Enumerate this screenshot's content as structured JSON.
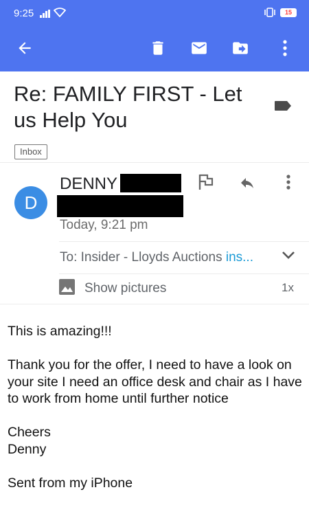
{
  "status_bar": {
    "time": "9:25",
    "battery": "15"
  },
  "toolbar": {
    "back_icon": "arrow-left-icon",
    "delete_icon": "trash-icon",
    "mark_unread_icon": "mail-icon",
    "move_icon": "folder-move-icon",
    "more_icon": "more-vert-icon"
  },
  "email": {
    "subject": "Re: FAMILY FIRST - Let us Help You",
    "label_chip": "Inbox",
    "sender_initial": "D",
    "sender_name": "DENNY",
    "date": "Today, 9:21 pm",
    "to_prefix": "To: Insider - Lloyds Auctions ",
    "to_email": "ins...",
    "show_pictures": "Show pictures",
    "zoom": "1x",
    "body": {
      "line1": "This is amazing!!!",
      "para2": "Thank you for the offer, I need to have a look on your site I need an office desk and chair as I have to work from home until further notice",
      "line3": "Cheers",
      "line4": "Denny",
      "signature": "Sent from my iPhone"
    }
  },
  "colors": {
    "app_bar": "#4e74f0",
    "avatar": "#3b8de4",
    "link": "#1a9ad6"
  }
}
